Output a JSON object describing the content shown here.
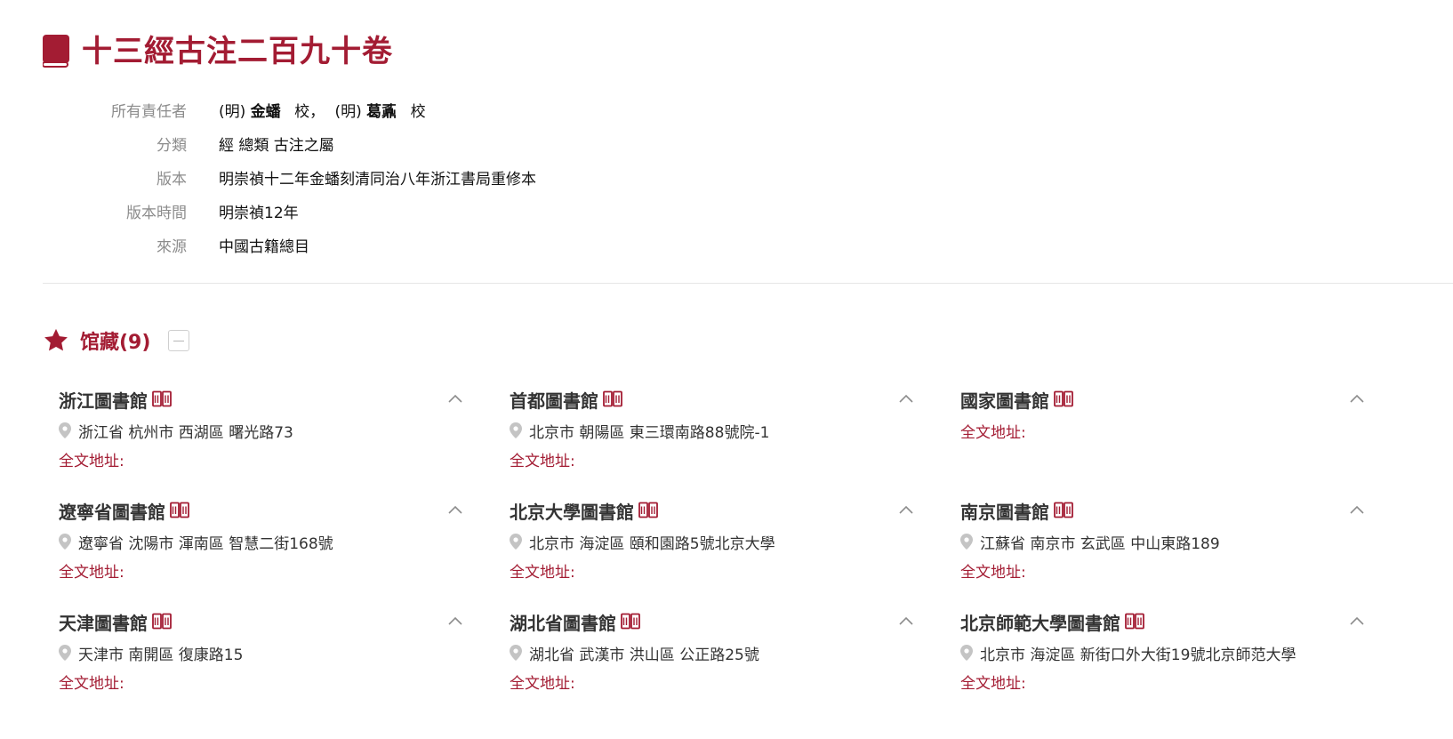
{
  "record": {
    "title": "十三經古注二百九十卷",
    "meta": {
      "responsibility": {
        "label": "所有責任者",
        "items": [
          {
            "prefix": "(明)",
            "name": "金蟠",
            "role": "校"
          },
          {
            "prefix": "(明)",
            "name": "葛鼒",
            "role": "校"
          }
        ],
        "separator": "，"
      },
      "classification": {
        "label": "分類",
        "value": "經 總類 古注之屬"
      },
      "edition": {
        "label": "版本",
        "value": "明崇禎十二年金蟠刻清同治八年浙江書局重修本"
      },
      "edition_time": {
        "label": "版本時間",
        "value": "明崇禎12年"
      },
      "source": {
        "label": "來源",
        "value": "中國古籍總目"
      }
    }
  },
  "holdings": {
    "title": "馆藏(9)",
    "fulltext_label": "全文地址:",
    "libraries": [
      {
        "name": "浙江圖書館",
        "address": "浙江省 杭州市 西湖區 曙光路73"
      },
      {
        "name": "首都圖書館",
        "address": "北京市 朝陽區 東三環南路88號院-1"
      },
      {
        "name": "國家圖書館",
        "address": ""
      },
      {
        "name": "遼寧省圖書館",
        "address": "遼寧省 沈陽市 渾南區 智慧二街168號"
      },
      {
        "name": "北京大學圖書館",
        "address": "北京市 海淀區 頤和園路5號北京大學"
      },
      {
        "name": "南京圖書館",
        "address": "江蘇省 南京市 玄武區 中山東路189"
      },
      {
        "name": "天津圖書館",
        "address": "天津市 南開區 復康路15"
      },
      {
        "name": "湖北省圖書館",
        "address": "湖北省 武漢市 洪山區 公正路25號"
      },
      {
        "name": "北京師範大學圖書館",
        "address": "北京市 海淀區 新街口外大街19號北京師范大學"
      }
    ]
  },
  "colors": {
    "accent": "#a31c33",
    "label": "#8c8c8c",
    "icon_gray": "#c4c4c4"
  },
  "icons": {
    "title": "book-icon",
    "holdings": "star-icon",
    "library": "open-book-icon",
    "expand": "chevron-up-icon",
    "address": "map-pin-icon",
    "collapse": "minus-box-icon"
  }
}
